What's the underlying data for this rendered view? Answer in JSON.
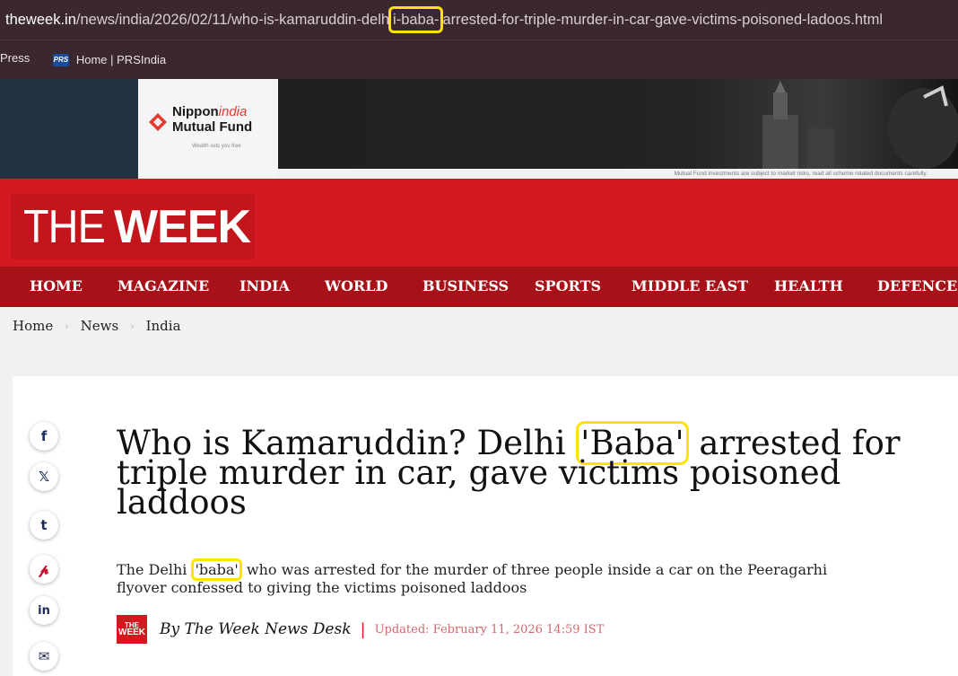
{
  "browser": {
    "url_domain": "theweek.in",
    "url_path_before": "/news/india/2026/02/11/who-is-kamaruddin-delh",
    "url_highlight": "i-baba-",
    "url_path_after": "arrested-for-triple-murder-in-car-gave-victims-poisoned-ladoos.html",
    "bookmarks": [
      {
        "label": "Press"
      },
      {
        "label": "Home | PRSIndia",
        "icon": "PRS"
      }
    ]
  },
  "ad": {
    "brand_line1": "Nippon",
    "brand_line1_accent": "india",
    "brand_line2": "Mutual Fund",
    "tagline": "Wealth sets you free",
    "disclaimer": "Mutual Fund investments are subject to market risks, read all scheme related documents carefully."
  },
  "site": {
    "logo_the": "THE",
    "logo_week": "WEEK",
    "badge_top": "THE",
    "badge_bottom": "WEEK",
    "nav": [
      "HOME",
      "MAGAZINE",
      "INDIA",
      "WORLD",
      "BUSINESS",
      "SPORTS",
      "MIDDLE EAST",
      "HEALTH",
      "DEFENCE"
    ]
  },
  "breadcrumb": [
    "Home",
    "News",
    "India"
  ],
  "article": {
    "headline_part1": "Who is Kamaruddin? Delhi ",
    "headline_highlight": "'Baba'",
    "headline_part2": " arrested for triple murder in car, gave victims poisoned laddoos",
    "summary_part1": "The Delhi ",
    "summary_highlight": "'baba'",
    "summary_part2": " who was arrested for the murder of three people inside a car on the Peeragarhi flyover confessed to giving the victims poisoned laddoos",
    "byline": "By The Week News Desk",
    "byline_separator": "|",
    "updated": "Updated: February 11, 2026 14:59 IST"
  },
  "share_icons": [
    {
      "name": "facebook-icon",
      "glyph": "f"
    },
    {
      "name": "x-twitter-icon",
      "glyph": "𝕏"
    },
    {
      "name": "tumblr-icon",
      "glyph": "t"
    },
    {
      "name": "pinterest-icon",
      "glyph": "𝓅"
    },
    {
      "name": "linkedin-icon",
      "glyph": "in"
    },
    {
      "name": "email-icon",
      "glyph": "✉"
    }
  ],
  "colors": {
    "brand_red": "#d31820",
    "nav_red": "#a71218",
    "highlight_yellow": "#ffe400"
  }
}
